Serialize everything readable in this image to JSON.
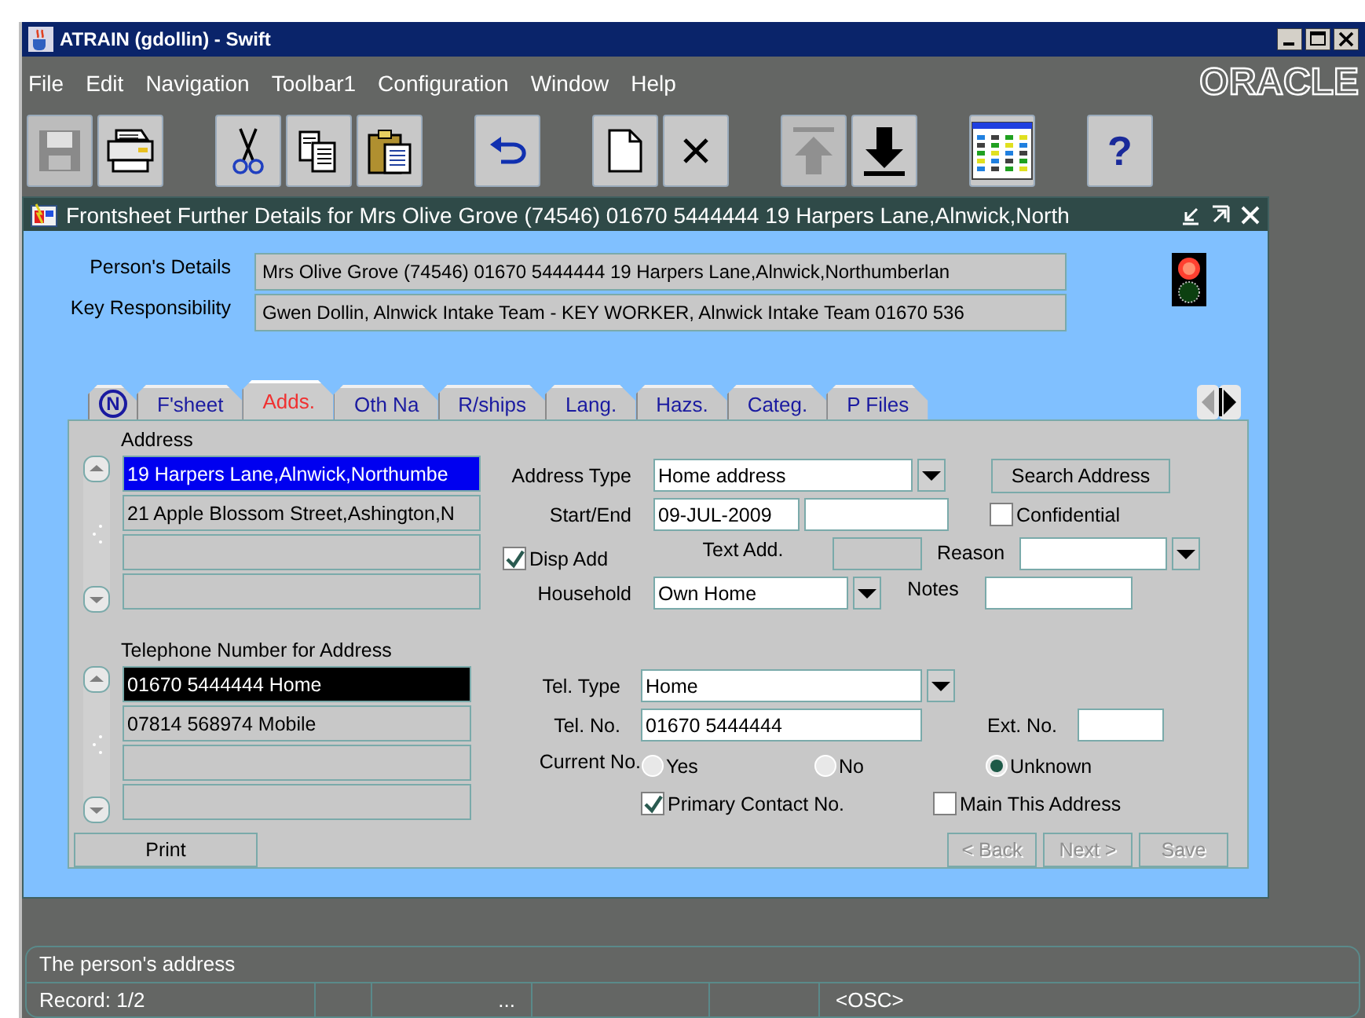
{
  "window": {
    "title": "ATRAIN (gdollin) - Swift"
  },
  "menu": [
    "File",
    "Edit",
    "Navigation",
    "Toolbar1",
    "Configuration",
    "Window",
    "Help"
  ],
  "logo": "ORACLE",
  "toolbar": [
    {
      "kind": "save",
      "disabled": true
    },
    {
      "kind": "print",
      "disabled": false
    },
    {
      "kind": "cut",
      "disabled": false
    },
    {
      "kind": "copy",
      "disabled": false
    },
    {
      "kind": "paste",
      "disabled": false
    },
    {
      "kind": "undo",
      "disabled": false
    },
    {
      "kind": "new",
      "disabled": false
    },
    {
      "kind": "delete",
      "disabled": false
    },
    {
      "kind": "up",
      "disabled": true
    },
    {
      "kind": "down",
      "disabled": false
    },
    {
      "kind": "palette",
      "disabled": false
    },
    {
      "kind": "help",
      "label": "?",
      "disabled": false
    }
  ],
  "form": {
    "title": "Frontsheet Further Details for  Mrs Olive Grove (74546) 01670 5444444 19 Harpers Lane,Alnwick,North",
    "header_fields": [
      {
        "label": "Person's Details",
        "value": "Mrs Olive Grove (74546) 01670 5444444 19 Harpers Lane,Alnwick,Northumberlan"
      },
      {
        "label": "Key Responsibility",
        "value": "Gwen Dollin, Alnwick Intake Team - KEY WORKER, Alnwick Intake Team 01670 536"
      }
    ],
    "tabs": [
      {
        "kind": "icon",
        "label": "N",
        "selected": false
      },
      {
        "kind": "text",
        "label": "F'sheet",
        "selected": false
      },
      {
        "kind": "text",
        "label": "Adds.",
        "selected": true
      },
      {
        "kind": "text",
        "label": "Oth Na",
        "selected": false
      },
      {
        "kind": "text",
        "label": "R/ships",
        "selected": false
      },
      {
        "kind": "text",
        "label": "Lang.",
        "selected": false
      },
      {
        "kind": "text",
        "label": "Hazs.",
        "selected": false
      },
      {
        "kind": "text",
        "label": "Categ.",
        "selected": false
      },
      {
        "kind": "text",
        "label": "P Files",
        "selected": false
      }
    ],
    "address": {
      "heading": "Address",
      "records": [
        {
          "value": "19 Harpers Lane,Alnwick,Northumbe",
          "selected": true
        },
        {
          "value": "21 Apple Blossom Street,Ashington,N",
          "selected": false
        },
        {
          "selected": false
        },
        {
          "selected": false
        }
      ]
    },
    "address_type": {
      "label": "Address Type",
      "value": "Home address"
    },
    "search_button": "Search Address",
    "start_end": {
      "label": "Start/End",
      "start": "09-JUL-2009"
    },
    "confidential": {
      "label": "Confidential",
      "checked": false
    },
    "disp_add": {
      "label": "Disp Add",
      "checked": true
    },
    "text_add": {
      "label": "Text Add.",
      "disabled": true
    },
    "reason": {
      "label": "Reason"
    },
    "household": {
      "label": "Household",
      "value": "Own Home"
    },
    "notes": {
      "label": "Notes"
    },
    "telephone": {
      "heading": "Telephone Number for Address",
      "records": [
        {
          "value": "01670 5444444 Home",
          "selected": true
        },
        {
          "value": "07814 568974 Mobile",
          "selected": false
        },
        {
          "selected": false
        },
        {
          "selected": false
        }
      ]
    },
    "tel_type": {
      "label": "Tel. Type",
      "value": "Home"
    },
    "tel_no": {
      "label": "Tel. No.",
      "value": "01670 5444444"
    },
    "ext_no": {
      "label": "Ext. No."
    },
    "current_no": {
      "label": "Current No.",
      "options": [
        {
          "label": "Yes",
          "selected": false
        },
        {
          "label": "No",
          "selected": false
        },
        {
          "label": "Unknown",
          "selected": true
        }
      ]
    },
    "primary_contact": {
      "label": "Primary Contact No.",
      "checked": true
    },
    "main_address": {
      "label": "Main This Address",
      "checked": false
    },
    "print_button": "Print",
    "nav_buttons": [
      {
        "label": "< Back",
        "disabled": true
      },
      {
        "label": "Next >",
        "disabled": true
      },
      {
        "label": "Save",
        "disabled": true
      }
    ]
  },
  "status": {
    "message": "The person's address",
    "record": "Record: 1/2",
    "ellipsis": "...",
    "mode": "<OSC>"
  }
}
